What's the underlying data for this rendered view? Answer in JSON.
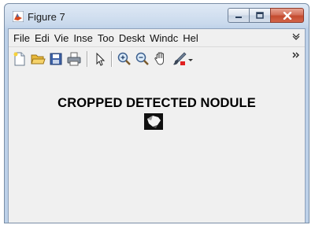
{
  "window": {
    "title": "Figure 7",
    "caption_buttons": [
      "minimize-icon",
      "maximize-icon",
      "close-icon"
    ]
  },
  "menubar": {
    "items": [
      "File",
      "Edi",
      "Vie",
      "Inse",
      "Too",
      "Deskt",
      "Windc",
      "Hel"
    ],
    "overflow_icon": "chevron-down-icon"
  },
  "toolbar": {
    "items": [
      "new-file-icon",
      "open-folder-icon",
      "save-icon",
      "print-icon",
      "pointer-icon",
      "zoom-in-icon",
      "zoom-out-icon",
      "pan-hand-icon",
      "brush-icon",
      "dropdown-arrow-icon"
    ],
    "overflow_icon": "double-chevron-right-icon"
  },
  "figure": {
    "title": "CROPPED DETECTED NODULE"
  },
  "colors": {
    "title_bar": "#c9d9ec",
    "client_bg": "#f0f0f0",
    "close_button": "#c44b2f"
  }
}
